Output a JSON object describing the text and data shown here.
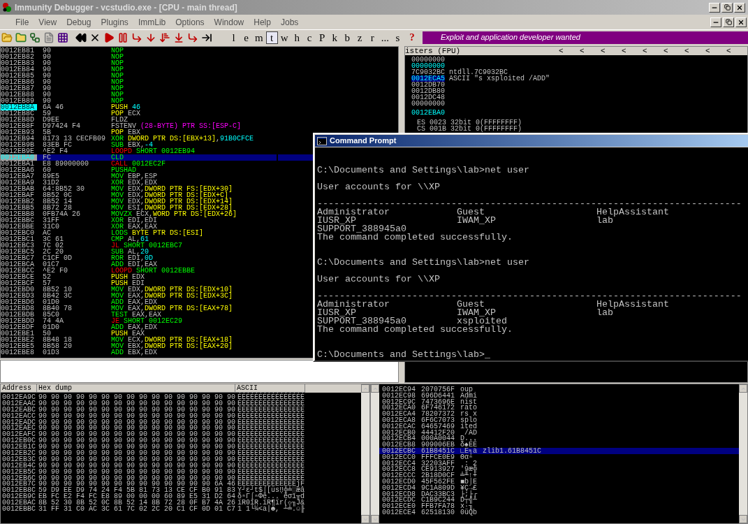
{
  "window": {
    "title": "Immunity Debugger - vcstudio.exe - [CPU - main thread]"
  },
  "menu": [
    "File",
    "View",
    "Debug",
    "Plugins",
    "ImmLib",
    "Options",
    "Window",
    "Help",
    "Jobs"
  ],
  "toolbar": {
    "letters": [
      {
        "label": "l",
        "selected": false
      },
      {
        "label": "e",
        "selected": false
      },
      {
        "label": "m",
        "selected": false
      },
      {
        "label": "t",
        "selected": true
      },
      {
        "label": "w",
        "selected": false
      },
      {
        "label": "h",
        "selected": false
      },
      {
        "label": "c",
        "selected": false
      },
      {
        "label": "P",
        "selected": false
      },
      {
        "label": "k",
        "selected": false
      },
      {
        "label": "b",
        "selected": false
      },
      {
        "label": "z",
        "selected": false
      },
      {
        "label": "r",
        "selected": false
      },
      {
        "label": "...",
        "selected": false
      },
      {
        "label": "s",
        "selected": false
      }
    ],
    "help": "?",
    "banner": "Exploit and application developer wanted"
  },
  "disassembly": {
    "rows": [
      {
        "address": "0012EB81",
        "hex": "90",
        "code": [
          {
            "kind": "cmd",
            "text": "NOP"
          }
        ],
        "selected": false,
        "eip": false
      },
      {
        "address": "0012EB82",
        "hex": "90",
        "code": [
          {
            "kind": "cmd",
            "text": "NOP"
          }
        ],
        "selected": false,
        "eip": false
      },
      {
        "address": "0012EB83",
        "hex": "90",
        "code": [
          {
            "kind": "cmd",
            "text": "NOP"
          }
        ],
        "selected": false,
        "eip": false
      },
      {
        "address": "0012EB84",
        "hex": "90",
        "code": [
          {
            "kind": "cmd",
            "text": "NOP"
          }
        ],
        "selected": false,
        "eip": false
      },
      {
        "address": "0012EB85",
        "hex": "90",
        "code": [
          {
            "kind": "cmd",
            "text": "NOP"
          }
        ],
        "selected": false,
        "eip": false
      },
      {
        "address": "0012EB86",
        "hex": "90",
        "code": [
          {
            "kind": "cmd",
            "text": "NOP"
          }
        ],
        "selected": false,
        "eip": false
      },
      {
        "address": "0012EB87",
        "hex": "90",
        "code": [
          {
            "kind": "cmd",
            "text": "NOP"
          }
        ],
        "selected": false,
        "eip": false
      },
      {
        "address": "0012EB88",
        "hex": "90",
        "code": [
          {
            "kind": "cmd",
            "text": "NOP"
          }
        ],
        "selected": false,
        "eip": false
      },
      {
        "address": "0012EB89",
        "hex": "90",
        "code": [
          {
            "kind": "cmd",
            "text": "NOP"
          }
        ],
        "selected": false,
        "eip": false
      },
      {
        "address": "0012EB8A",
        "hex": "6A 46",
        "code": [
          {
            "kind": "stk",
            "text": "PUSH "
          },
          {
            "kind": "imm",
            "text": "46"
          }
        ],
        "selected": false,
        "eip": true
      },
      {
        "address": "0012EB8C",
        "hex": "59",
        "code": [
          {
            "kind": "stk",
            "text": "POP "
          },
          {
            "kind": "reg",
            "text": "ECX"
          }
        ],
        "selected": false,
        "eip": false
      },
      {
        "address": "0012EB8D",
        "hex": "D9EE",
        "code": [
          {
            "kind": "reg",
            "text": "FLDZ"
          }
        ],
        "selected": false,
        "eip": false
      },
      {
        "address": "0012EB8F",
        "hex": "D97424 F4",
        "code": [
          {
            "kind": "reg",
            "text": "FSTENV "
          },
          {
            "kind": "fpu",
            "text": "(28-BYTE) PTR SS:[ESP-C]"
          }
        ],
        "selected": false,
        "eip": false
      },
      {
        "address": "0012EB93",
        "hex": "5B",
        "code": [
          {
            "kind": "stk",
            "text": "POP "
          },
          {
            "kind": "reg",
            "text": "EBX"
          }
        ],
        "selected": false,
        "eip": false
      },
      {
        "address": "0012EB94",
        "hex": "8173 13 CECFB09",
        "code": [
          {
            "kind": "cmd",
            "text": "XOR "
          },
          {
            "kind": "mem",
            "text": "DWORD PTR DS:[EBX+13]"
          },
          {
            "kind": "reg",
            "text": ","
          },
          {
            "kind": "imm",
            "text": "91B0CFCE"
          }
        ],
        "selected": false,
        "eip": false
      },
      {
        "address": "0012EB9B",
        "hex": "83EB FC",
        "code": [
          {
            "kind": "cmd",
            "text": "SUB "
          },
          {
            "kind": "reg",
            "text": "EBX,"
          },
          {
            "kind": "imm",
            "text": "-4"
          }
        ],
        "selected": false,
        "eip": false
      },
      {
        "address": "0012EB9E",
        "hex": "^E2 F4",
        "code": [
          {
            "kind": "jmp",
            "text": "LOOPD "
          },
          {
            "kind": "cmd",
            "text": "SHORT 0012EB94"
          }
        ],
        "selected": false,
        "eip": false
      },
      {
        "address": "0012EBA0",
        "hex": "FC",
        "code": [
          {
            "kind": "cmd",
            "text": "CLD"
          }
        ],
        "selected": true,
        "eip": false
      },
      {
        "address": "0012EBA1",
        "hex": "E8 89000000",
        "code": [
          {
            "kind": "jmp",
            "text": "CALL "
          },
          {
            "kind": "cmd",
            "text": "0012EC2F"
          }
        ],
        "selected": false,
        "eip": false
      },
      {
        "address": "0012EBA6",
        "hex": "60",
        "code": [
          {
            "kind": "cmd",
            "text": "PUSHAD"
          }
        ],
        "selected": false,
        "eip": false
      },
      {
        "address": "0012EBA7",
        "hex": "89E5",
        "code": [
          {
            "kind": "cmd",
            "text": "MOV "
          },
          {
            "kind": "reg",
            "text": "EBP,ESP"
          }
        ],
        "selected": false,
        "eip": false
      },
      {
        "address": "0012EBA9",
        "hex": "31D2",
        "code": [
          {
            "kind": "cmd",
            "text": "XOR "
          },
          {
            "kind": "reg",
            "text": "EDX,EDX"
          }
        ],
        "selected": false,
        "eip": false
      },
      {
        "address": "0012EBAB",
        "hex": "64:8B52 30",
        "code": [
          {
            "kind": "cmd",
            "text": "MOV "
          },
          {
            "kind": "reg",
            "text": "EDX,"
          },
          {
            "kind": "mem",
            "text": "DWORD PTR FS:[EDX+30]"
          }
        ],
        "selected": false,
        "eip": false
      },
      {
        "address": "0012EBAF",
        "hex": "8B52 0C",
        "code": [
          {
            "kind": "cmd",
            "text": "MOV "
          },
          {
            "kind": "reg",
            "text": "EDX,"
          },
          {
            "kind": "mem",
            "text": "DWORD PTR DS:[EDX+C]"
          }
        ],
        "selected": false,
        "eip": false
      },
      {
        "address": "0012EBB2",
        "hex": "8B52 14",
        "code": [
          {
            "kind": "cmd",
            "text": "MOV "
          },
          {
            "kind": "reg",
            "text": "EDX,"
          },
          {
            "kind": "mem",
            "text": "DWORD PTR DS:[EDX+14]"
          }
        ],
        "selected": false,
        "eip": false
      },
      {
        "address": "0012EBB5",
        "hex": "8B72 28",
        "code": [
          {
            "kind": "cmd",
            "text": "MOV "
          },
          {
            "kind": "reg",
            "text": "ESI,"
          },
          {
            "kind": "mem",
            "text": "DWORD PTR DS:[EDX+28]"
          }
        ],
        "selected": false,
        "eip": false
      },
      {
        "address": "0012EBB8",
        "hex": "0FB74A 26",
        "code": [
          {
            "kind": "cmd",
            "text": "MOVZX "
          },
          {
            "kind": "reg",
            "text": "ECX,"
          },
          {
            "kind": "mem",
            "text": "WORD PTR DS:[EDX+26]"
          }
        ],
        "selected": false,
        "eip": false
      },
      {
        "address": "0012EBBC",
        "hex": "31FF",
        "code": [
          {
            "kind": "cmd",
            "text": "XOR "
          },
          {
            "kind": "reg",
            "text": "EDI,EDI"
          }
        ],
        "selected": false,
        "eip": false
      },
      {
        "address": "0012EBBE",
        "hex": "31C0",
        "code": [
          {
            "kind": "cmd",
            "text": "XOR "
          },
          {
            "kind": "reg",
            "text": "EAX,EAX"
          }
        ],
        "selected": false,
        "eip": false
      },
      {
        "address": "0012EBC0",
        "hex": "AC",
        "code": [
          {
            "kind": "cmd",
            "text": "LODS "
          },
          {
            "kind": "mem",
            "text": "BYTE PTR DS:[ESI]"
          }
        ],
        "selected": false,
        "eip": false
      },
      {
        "address": "0012EBC1",
        "hex": "3C 61",
        "code": [
          {
            "kind": "cmd",
            "text": "CMP "
          },
          {
            "kind": "reg",
            "text": "AL,"
          },
          {
            "kind": "imm",
            "text": "61"
          }
        ],
        "selected": false,
        "eip": false
      },
      {
        "address": "0012EBC3",
        "hex": "7C 02",
        "code": [
          {
            "kind": "jmp",
            "text": "JL "
          },
          {
            "kind": "cmd",
            "text": "SHORT 0012EBC7"
          }
        ],
        "selected": false,
        "eip": false
      },
      {
        "address": "0012EBC5",
        "hex": "2C 20",
        "code": [
          {
            "kind": "cmd",
            "text": "SUB "
          },
          {
            "kind": "reg",
            "text": "AL,"
          },
          {
            "kind": "imm",
            "text": "20"
          }
        ],
        "selected": false,
        "eip": false
      },
      {
        "address": "0012EBC7",
        "hex": "C1CF 0D",
        "code": [
          {
            "kind": "cmd",
            "text": "ROR "
          },
          {
            "kind": "reg",
            "text": "EDI,"
          },
          {
            "kind": "imm",
            "text": "0D"
          }
        ],
        "selected": false,
        "eip": false
      },
      {
        "address": "0012EBCA",
        "hex": "01C7",
        "code": [
          {
            "kind": "cmd",
            "text": "ADD "
          },
          {
            "kind": "reg",
            "text": "EDI,EAX"
          }
        ],
        "selected": false,
        "eip": false
      },
      {
        "address": "0012EBCC",
        "hex": "^E2 F0",
        "code": [
          {
            "kind": "jmp",
            "text": "LOOPD "
          },
          {
            "kind": "cmd",
            "text": "SHORT 0012EBBE"
          }
        ],
        "selected": false,
        "eip": false
      },
      {
        "address": "0012EBCE",
        "hex": "52",
        "code": [
          {
            "kind": "stk",
            "text": "PUSH "
          },
          {
            "kind": "reg",
            "text": "EDX"
          }
        ],
        "selected": false,
        "eip": false
      },
      {
        "address": "0012EBCF",
        "hex": "57",
        "code": [
          {
            "kind": "stk",
            "text": "PUSH "
          },
          {
            "kind": "reg",
            "text": "EDI"
          }
        ],
        "selected": false,
        "eip": false
      },
      {
        "address": "0012EBD0",
        "hex": "8B52 10",
        "code": [
          {
            "kind": "cmd",
            "text": "MOV "
          },
          {
            "kind": "reg",
            "text": "EDX,"
          },
          {
            "kind": "mem",
            "text": "DWORD PTR DS:[EDX+10]"
          }
        ],
        "selected": false,
        "eip": false
      },
      {
        "address": "0012EBD3",
        "hex": "8B42 3C",
        "code": [
          {
            "kind": "cmd",
            "text": "MOV "
          },
          {
            "kind": "reg",
            "text": "EAX,"
          },
          {
            "kind": "mem",
            "text": "DWORD PTR DS:[EDX+3C]"
          }
        ],
        "selected": false,
        "eip": false
      },
      {
        "address": "0012EBD6",
        "hex": "01D0",
        "code": [
          {
            "kind": "cmd",
            "text": "ADD "
          },
          {
            "kind": "reg",
            "text": "EAX,EDX"
          }
        ],
        "selected": false,
        "eip": false
      },
      {
        "address": "0012EBD8",
        "hex": "8B40 78",
        "code": [
          {
            "kind": "cmd",
            "text": "MOV "
          },
          {
            "kind": "reg",
            "text": "EAX,"
          },
          {
            "kind": "mem",
            "text": "DWORD PTR DS:[EAX+78]"
          }
        ],
        "selected": false,
        "eip": false
      },
      {
        "address": "0012EBDB",
        "hex": "85C0",
        "code": [
          {
            "kind": "cmd",
            "text": "TEST "
          },
          {
            "kind": "reg",
            "text": "EAX,EAX"
          }
        ],
        "selected": false,
        "eip": false
      },
      {
        "address": "0012EBDD",
        "hex": "74 4A",
        "code": [
          {
            "kind": "jmp",
            "text": "JE "
          },
          {
            "kind": "cmd",
            "text": "SHORT 0012EC29"
          }
        ],
        "selected": false,
        "eip": false
      },
      {
        "address": "0012EBDF",
        "hex": "01D0",
        "code": [
          {
            "kind": "cmd",
            "text": "ADD "
          },
          {
            "kind": "reg",
            "text": "EAX,EDX"
          }
        ],
        "selected": false,
        "eip": false
      },
      {
        "address": "0012EBE1",
        "hex": "50",
        "code": [
          {
            "kind": "stk",
            "text": "PUSH "
          },
          {
            "kind": "reg",
            "text": "EAX"
          }
        ],
        "selected": false,
        "eip": false
      },
      {
        "address": "0012EBE2",
        "hex": "8B48 18",
        "code": [
          {
            "kind": "cmd",
            "text": "MOV "
          },
          {
            "kind": "reg",
            "text": "ECX,"
          },
          {
            "kind": "mem",
            "text": "DWORD PTR DS:[EAX+18]"
          }
        ],
        "selected": false,
        "eip": false
      },
      {
        "address": "0012EBE5",
        "hex": "8B58 20",
        "code": [
          {
            "kind": "cmd",
            "text": "MOV "
          },
          {
            "kind": "reg",
            "text": "EBX,"
          },
          {
            "kind": "mem",
            "text": "DWORD PTR DS:[EAX+20]"
          }
        ],
        "selected": false,
        "eip": false
      },
      {
        "address": "0012EBE8",
        "hex": "01D3",
        "code": [
          {
            "kind": "cmd",
            "text": "ADD "
          },
          {
            "kind": "reg",
            "text": "EBX,EDX"
          }
        ],
        "selected": false,
        "eip": false
      }
    ]
  },
  "registers": {
    "header": "isters (FPU)",
    "arrows": [
      "<",
      "<",
      "<",
      "<",
      "<",
      "<",
      "<",
      "<",
      "<"
    ],
    "general": [
      {
        "value": "00000000",
        "changed": false,
        "selected": false
      },
      {
        "value": "00000000",
        "changed": true,
        "selected": false
      },
      {
        "value": "7C9032BC",
        "comment": "ntdll.7C9032BC",
        "changed": false,
        "selected": false
      },
      {
        "value": "0012ECA5",
        "comment": "ASCII \"s xsploited /ADD\"",
        "changed": true,
        "selected": true
      },
      {
        "value": "0012DB70",
        "changed": false,
        "selected": false
      },
      {
        "value": "0012DB80",
        "changed": false,
        "selected": false
      },
      {
        "value": "0012DC48",
        "changed": false,
        "selected": false
      },
      {
        "value": "00000000",
        "changed": false,
        "selected": false
      }
    ],
    "ip": {
      "value": "0012EBA0",
      "changed": true
    },
    "segments": [
      "ES 0023 32bit 0(FFFFFFFF)",
      "CS 001B 32bit 0(FFFFFFFF)"
    ]
  },
  "console": {
    "title": "Command Prompt",
    "sessions": [
      {
        "command": "C:\\Documents and Settings\\lab>net user",
        "heading": "User accounts for \\\\XP",
        "rule": "----------------------------------------------------------------------------",
        "rows": [
          "Administrator            Guest                    HelpAssistant",
          "IUSR_XP                  IWAM_XP                  lab",
          "SUPPORT_388945a0"
        ],
        "status": "The command completed successfully."
      },
      {
        "command": "C:\\Documents and Settings\\lab>net user",
        "heading": "User accounts for \\\\XP",
        "rule": "----------------------------------------------------------------------------",
        "rows": [
          "Administrator            Guest                    HelpAssistant",
          "IUSR_XP                  IWAM_XP                  lab",
          "SUPPORT_388945a0         xsploited"
        ],
        "status": "The command completed successfully."
      }
    ],
    "prompt": "C:\\Documents and Settings\\lab>_"
  },
  "dump": {
    "columns": [
      "Address",
      "Hex dump",
      "ASCII"
    ],
    "rows": [
      {
        "address": "0012EA9C",
        "hex": "90 90 90 90 90 90 90 90 90 90 90 90 90 90 90 90",
        "ascii": "ÉÉÉÉÉÉÉÉÉÉÉÉÉÉÉÉ"
      },
      {
        "address": "0012EAAC",
        "hex": "90 90 90 90 90 90 90 90 90 90 90 90 90 90 90 90",
        "ascii": "ÉÉÉÉÉÉÉÉÉÉÉÉÉÉÉÉ"
      },
      {
        "address": "0012EABC",
        "hex": "90 90 90 90 90 90 90 90 90 90 90 90 90 90 90 90",
        "ascii": "ÉÉÉÉÉÉÉÉÉÉÉÉÉÉÉÉ"
      },
      {
        "address": "0012EACC",
        "hex": "90 90 90 90 90 90 90 90 90 90 90 90 90 90 90 90",
        "ascii": "ÉÉÉÉÉÉÉÉÉÉÉÉÉÉÉÉ"
      },
      {
        "address": "0012EADC",
        "hex": "90 90 90 90 90 90 90 90 90 90 90 90 90 90 90 90",
        "ascii": "ÉÉÉÉÉÉÉÉÉÉÉÉÉÉÉÉ"
      },
      {
        "address": "0012EAEC",
        "hex": "90 90 90 90 90 90 90 90 90 90 90 90 90 90 90 90",
        "ascii": "ÉÉÉÉÉÉÉÉÉÉÉÉÉÉÉÉ"
      },
      {
        "address": "0012EAFC",
        "hex": "90 90 90 90 90 90 90 90 90 90 90 90 90 90 90 90",
        "ascii": "ÉÉÉÉÉÉÉÉÉÉÉÉÉÉÉÉ"
      },
      {
        "address": "0012EB0C",
        "hex": "90 90 90 90 90 90 90 90 90 90 90 90 90 90 90 90",
        "ascii": "ÉÉÉÉÉÉÉÉÉÉÉÉÉÉÉÉ"
      },
      {
        "address": "0012EB1C",
        "hex": "90 90 90 90 90 90 90 90 90 90 90 90 90 90 90 90",
        "ascii": "ÉÉÉÉÉÉÉÉÉÉÉÉÉÉÉÉ"
      },
      {
        "address": "0012EB2C",
        "hex": "90 90 90 90 90 90 90 90 90 90 90 90 90 90 90 90",
        "ascii": "ÉÉÉÉÉÉÉÉÉÉÉÉÉÉÉÉ"
      },
      {
        "address": "0012EB3C",
        "hex": "90 90 90 90 90 90 90 90 90 90 90 90 90 90 90 90",
        "ascii": "ÉÉÉÉÉÉÉÉÉÉÉÉÉÉÉÉ"
      },
      {
        "address": "0012EB4C",
        "hex": "90 90 90 90 90 90 90 90 90 90 90 90 90 90 90 90",
        "ascii": "ÉÉÉÉÉÉÉÉÉÉÉÉÉÉÉÉ"
      },
      {
        "address": "0012EB5C",
        "hex": "90 90 90 90 90 90 90 90 90 90 90 90 90 90 90 90",
        "ascii": "ÉÉÉÉÉÉÉÉÉÉÉÉÉÉÉÉ"
      },
      {
        "address": "0012EB6C",
        "hex": "90 90 90 90 90 90 90 90 90 90 90 90 90 90 90 90",
        "ascii": "ÉÉÉÉÉÉÉÉÉÉÉÉÉÉÉÉ"
      },
      {
        "address": "0012EB7C",
        "hex": "90 90 90 90 90 90 90 90 90 90 90 90 90 90 6A 46",
        "ascii": "ÉÉÉÉÉÉÉÉÉÉÉÉÉÉjF"
      },
      {
        "address": "0012EB8C",
        "hex": "59 D9 EE D9 74 24 F4 5B 81 73 13 CE CF B0 91 83",
        "ascii": "Y┘ε┘t$⌠[üs‼╬╧░æâ"
      },
      {
        "address": "0012EB9C",
        "hex": "EB FC E2 F4 FC E8 89 00 00 00 60 89 E5 31 D2 64",
        "ascii": "δⁿΓ⌠ⁿΦë...`ëσ1╥d"
      },
      {
        "address": "0012EBAC",
        "hex": "8B 52 30 8B 52 0C 8B 52 14 8B 72 28 0F B7 4A 26",
        "ascii": "ïR0ïR.ïR¶ïr(☼╖J&"
      },
      {
        "address": "0012EBBC",
        "hex": "31 FF 31 C0 AC 3C 61 7C 02 2C 20 C1 CF 0D 01 C7",
        "ascii": "1 1└¼<a|☻, ┴╧.☺╟"
      }
    ]
  },
  "stack": {
    "rows": [
      {
        "address": "0012EC94",
        "value": "2070756F",
        "ascii": "oup",
        "selected": false
      },
      {
        "address": "0012EC98",
        "value": "696D6441",
        "ascii": "Admi",
        "selected": false
      },
      {
        "address": "0012EC9C",
        "value": "7473696E",
        "ascii": "nist",
        "selected": false
      },
      {
        "address": "0012ECA0",
        "value": "6F746172",
        "ascii": "rato",
        "selected": false
      },
      {
        "address": "0012ECA4",
        "value": "78207372",
        "ascii": "rs x",
        "selected": false
      },
      {
        "address": "0012ECA8",
        "value": "6F6C7073",
        "ascii": "splo",
        "selected": false
      },
      {
        "address": "0012ECAC",
        "value": "64657469",
        "ascii": "ited",
        "selected": false
      },
      {
        "address": "0012ECB0",
        "value": "44412F20",
        "ascii": " /AD",
        "selected": false
      },
      {
        "address": "0012ECB4",
        "value": "000A0044",
        "ascii": "D...",
        "selected": false
      },
      {
        "address": "0012ECB8",
        "value": "909006EB",
        "ascii": "δ♠ÉÉ",
        "selected": false
      },
      {
        "address": "0012ECBC",
        "value": "61B8451C",
        "ascii": "∟E╕a",
        "comment": "zlib1.61B8451C",
        "selected": true
      },
      {
        "address": "0012ECC0",
        "value": "FFFCE0E9",
        "ascii": "Θαⁿ",
        "selected": false
      },
      {
        "address": "0012ECC4",
        "value": "32203AFF",
        "ascii": " : 2",
        "selected": false
      },
      {
        "address": "0012ECC8",
        "value": "CE913927",
        "ascii": "'9æ╬",
        "selected": false
      },
      {
        "address": "0012ECCC",
        "value": "2B18D0CF",
        "ascii": "╧╨↑+",
        "selected": false
      },
      {
        "address": "0012ECD0",
        "value": "45F562FE",
        "ascii": "■b⌡E",
        "selected": false
      },
      {
        "address": "0012ECD4",
        "value": "9C1A809D",
        "ascii": "¥Ç→£",
        "selected": false
      },
      {
        "address": "0012ECD8",
        "value": "DAC33BC3",
        "ascii": "├;├┌",
        "selected": false
      },
      {
        "address": "0012ECDC",
        "value": "C1B9C244",
        "ascii": "D┬╣┴",
        "selected": false
      },
      {
        "address": "0012ECE0",
        "value": "FFB7FA78",
        "ascii": "x·╖",
        "selected": false
      },
      {
        "address": "0012ECE4",
        "value": "62518130",
        "ascii": "0üQb",
        "selected": false
      }
    ]
  }
}
